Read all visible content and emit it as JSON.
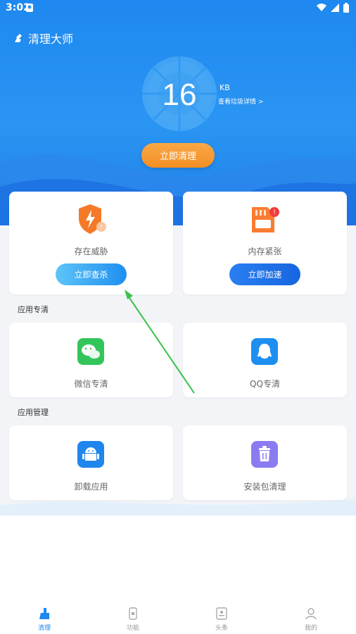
{
  "status_bar": {
    "time": "3:02"
  },
  "app": {
    "title": "清理大师"
  },
  "gauge": {
    "value": "16",
    "unit": "KB",
    "link": "查看垃圾详情 >"
  },
  "clean_button": "立即清理",
  "cards": {
    "threat": {
      "label": "存在威胁",
      "button": "立即查杀"
    },
    "memory": {
      "label": "内存紧张",
      "button": "立即加速"
    }
  },
  "sections": {
    "app_clean": {
      "title": "应用专清",
      "items": [
        {
          "label": "微信专清"
        },
        {
          "label": "QQ专清"
        }
      ]
    },
    "app_manage": {
      "title": "应用管理",
      "items": [
        {
          "label": "卸载应用"
        },
        {
          "label": "安装包清理"
        }
      ]
    }
  },
  "tabs": [
    {
      "label": "清理",
      "icon": "broom-icon",
      "active": true
    },
    {
      "label": "功能",
      "icon": "phone-icon",
      "active": false
    },
    {
      "label": "头条",
      "icon": "news-icon",
      "active": false
    },
    {
      "label": "我的",
      "icon": "person-icon",
      "active": false
    }
  ],
  "colors": {
    "primary": "#1e88f0",
    "orange": "#f48f24",
    "annotation_arrow": "#3cc24a"
  }
}
